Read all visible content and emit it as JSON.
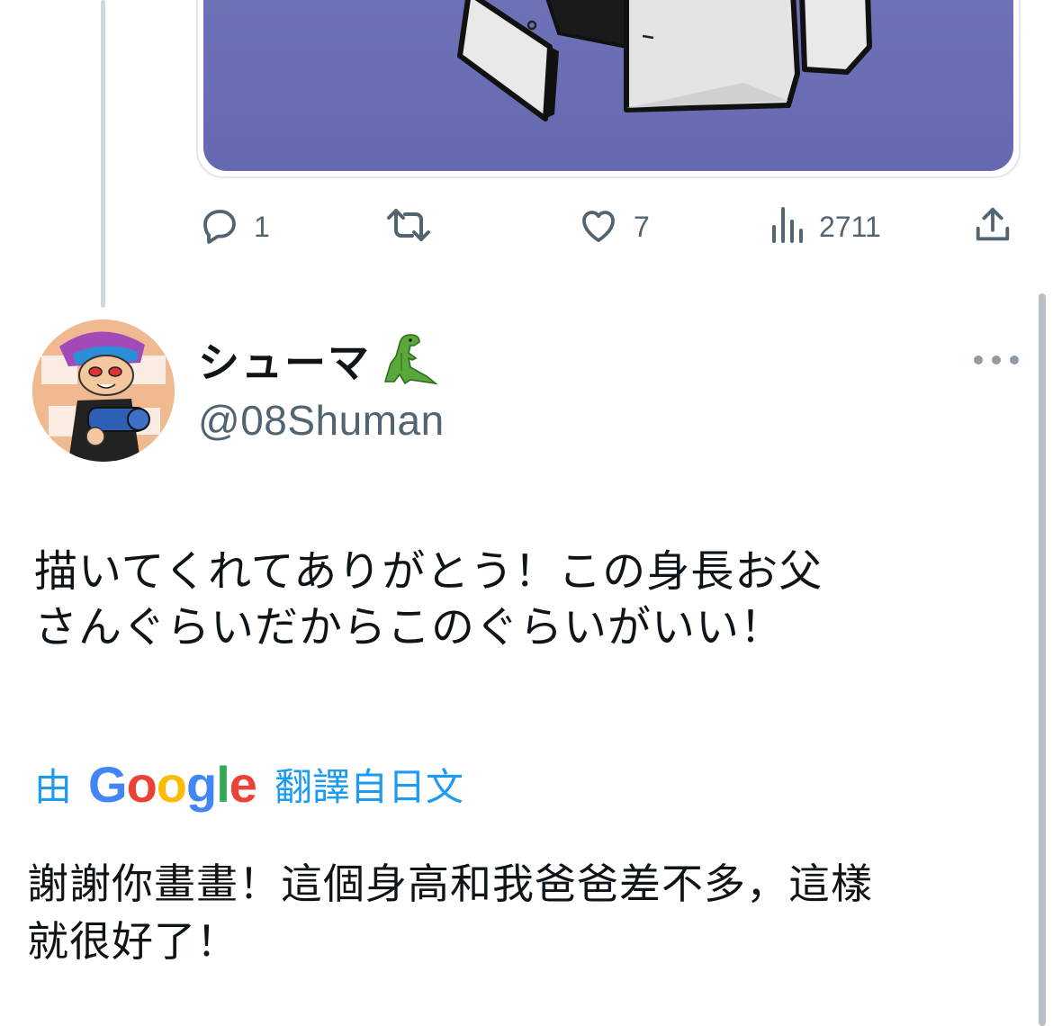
{
  "thread": {
    "actions": {
      "reply_count": "1",
      "retweet_count": "",
      "like_count": "7",
      "views_count": "2711"
    }
  },
  "reply": {
    "display_name": "シューマ",
    "handle": "@08Shuman",
    "text": "描いてくれてありがとう！この身長お父\nさんぐらいだからこのぐらいがいい！",
    "translation": {
      "prefix": "由",
      "provider": "Google",
      "source_language": "翻譯自日文",
      "text": "謝謝你畫畫！這個身高和我爸爸差不多，這樣\n就很好了！"
    }
  },
  "colors": {
    "accent": "#1d9bf0",
    "secondary_text": "#536471",
    "media_background": "#6f73b8"
  },
  "icons": [
    "reply-icon",
    "retweet-icon",
    "like-icon",
    "views-icon",
    "share-icon",
    "dinosaur-emoji",
    "more-icon"
  ]
}
